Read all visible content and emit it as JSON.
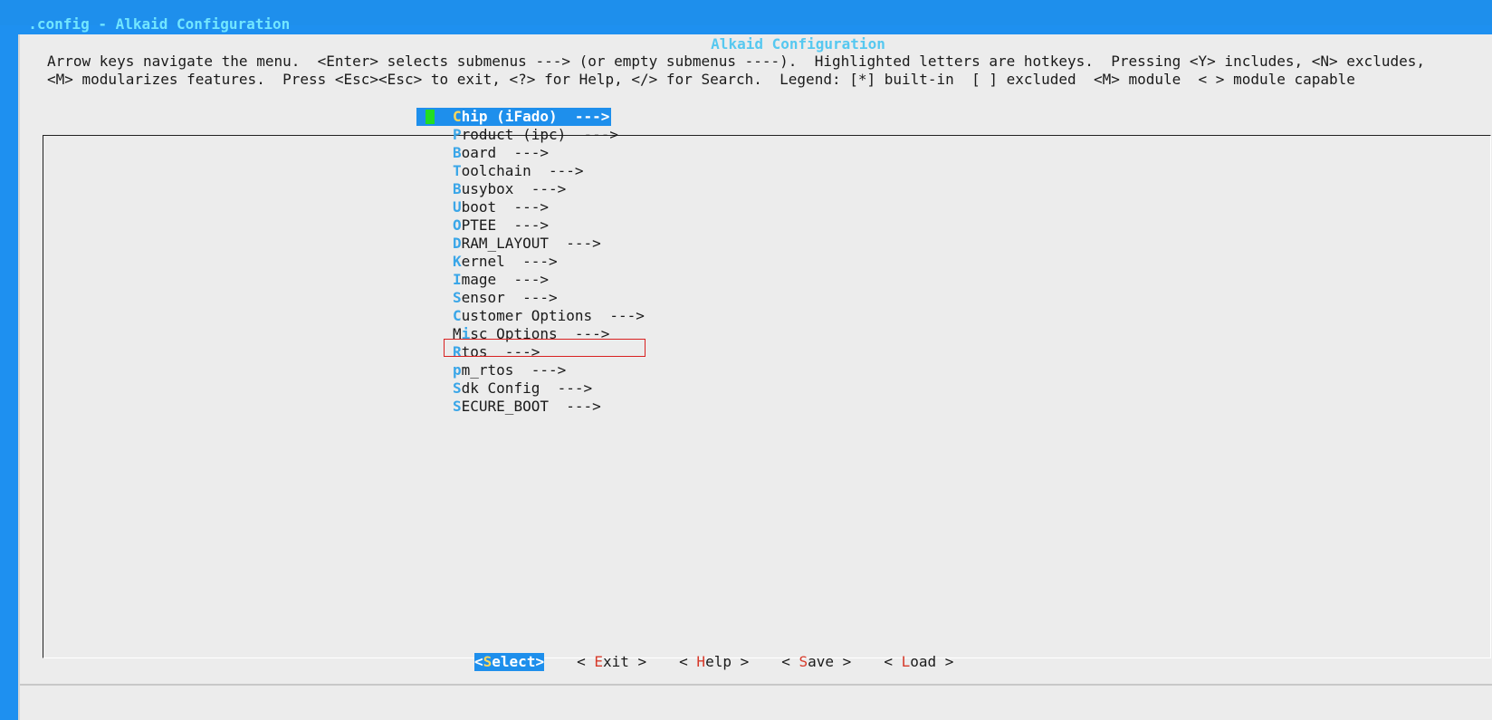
{
  "window": {
    "title": ".config - Alkaid Configuration"
  },
  "dialog": {
    "title": "Alkaid Configuration",
    "help_line1": "Arrow keys navigate the menu.  <Enter> selects submenus ---> (or empty submenus ----).  Highlighted letters are hotkeys.  Pressing <Y> includes, <N> excludes,",
    "help_line2": "<M> modularizes features.  Press <Esc><Esc> to exit, <?> for Help, </> for Search.  Legend: [*] built-in  [ ] excluded  <M> module  < > module capable"
  },
  "menu": {
    "items": [
      {
        "hot": "C",
        "rest": "hip (iFado)  --->",
        "selected": true
      },
      {
        "hot": "P",
        "rest": "roduct (ipc)  --->"
      },
      {
        "hot": "B",
        "rest": "oard  --->"
      },
      {
        "hot": "T",
        "rest": "oolchain  --->"
      },
      {
        "hot": "B",
        "rest": "usybox  --->"
      },
      {
        "hot": "U",
        "rest": "boot  --->"
      },
      {
        "hot": "O",
        "rest": "PTEE  --->"
      },
      {
        "hot": "D",
        "rest": "RAM_LAYOUT  --->"
      },
      {
        "hot": "K",
        "rest": "ernel  --->"
      },
      {
        "hot": "I",
        "rest": "mage  --->"
      },
      {
        "hot": "S",
        "rest": "ensor  --->"
      },
      {
        "hot": "C",
        "rest": "ustomer Options  --->",
        "annotated": true
      },
      {
        "pre": "M",
        "hot": "i",
        "rest": "sc Options  --->"
      },
      {
        "hot": "R",
        "rest": "tos  --->"
      },
      {
        "hot": "p",
        "rest": "m_rtos  --->"
      },
      {
        "hot": "S",
        "rest": "dk Config  --->"
      },
      {
        "hot": "S",
        "rest": "ECURE_BOOT  --->"
      }
    ]
  },
  "buttons": {
    "select": {
      "pre": "<",
      "hot": "S",
      "post": "elect>"
    },
    "exit": {
      "pre": "< ",
      "hot": "E",
      "post": "xit >"
    },
    "help": {
      "pre": "< ",
      "hot": "H",
      "post": "elp >"
    },
    "save": {
      "pre": "< ",
      "hot": "S",
      "post": "ave >"
    },
    "load": {
      "pre": "< ",
      "hot": "L",
      "post": "oad >"
    }
  },
  "colors": {
    "terminal_blue": "#1e8fec",
    "dialog_bg": "#ececec",
    "hotkey_blue": "#3aa6e8",
    "button_hotkey_red": "#d63a2a",
    "selected_hotkey_yellow": "#ffd75a",
    "cursor_green": "#22dd22",
    "annotation_red": "#d82020"
  }
}
